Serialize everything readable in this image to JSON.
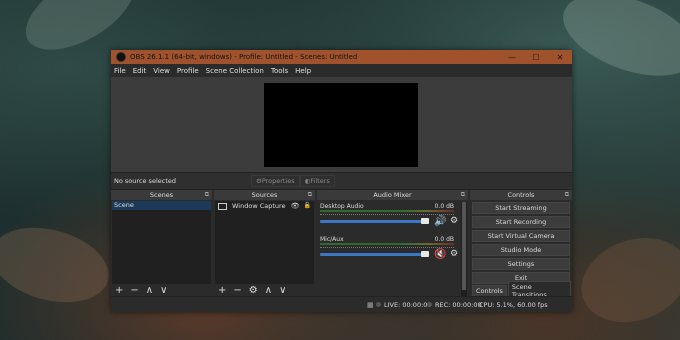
{
  "titlebar": {
    "title": "OBS 26.1.1 (64-bit, windows) - Profile: Untitled - Scenes: Untitled",
    "minimize": "—",
    "maximize": "☐",
    "close": "✕"
  },
  "menu": [
    "File",
    "Edit",
    "View",
    "Profile",
    "Scene Collection",
    "Tools",
    "Help"
  ],
  "propbar": {
    "no_source": "No source selected",
    "properties": "Properties",
    "filters": "Filters"
  },
  "scenes": {
    "title": "Scenes",
    "items": [
      "Scene"
    ]
  },
  "sources": {
    "title": "Sources",
    "items": [
      "Window Capture"
    ]
  },
  "mixer": {
    "title": "Audio Mixer",
    "channels": [
      {
        "name": "Desktop Audio",
        "db": "0.0 dB",
        "muted": false
      },
      {
        "name": "Mic/Aux",
        "db": "0.0 dB",
        "muted": true
      }
    ]
  },
  "controls": {
    "title": "Controls",
    "buttons": [
      "Start Streaming",
      "Start Recording",
      "Start Virtual Camera",
      "Studio Mode",
      "Settings",
      "Exit"
    ],
    "tabs": [
      "Controls",
      "Scene Transitions"
    ]
  },
  "status": {
    "live": "LIVE: 00:00:00",
    "rec": "REC: 00:00:00",
    "cpu": "CPU: 5.1%, 60.00 fps"
  },
  "colors": {
    "titlebar": "#a0522d",
    "selection": "#1e3a5a",
    "fader": "#3a78c4",
    "mute": "#c03030"
  }
}
